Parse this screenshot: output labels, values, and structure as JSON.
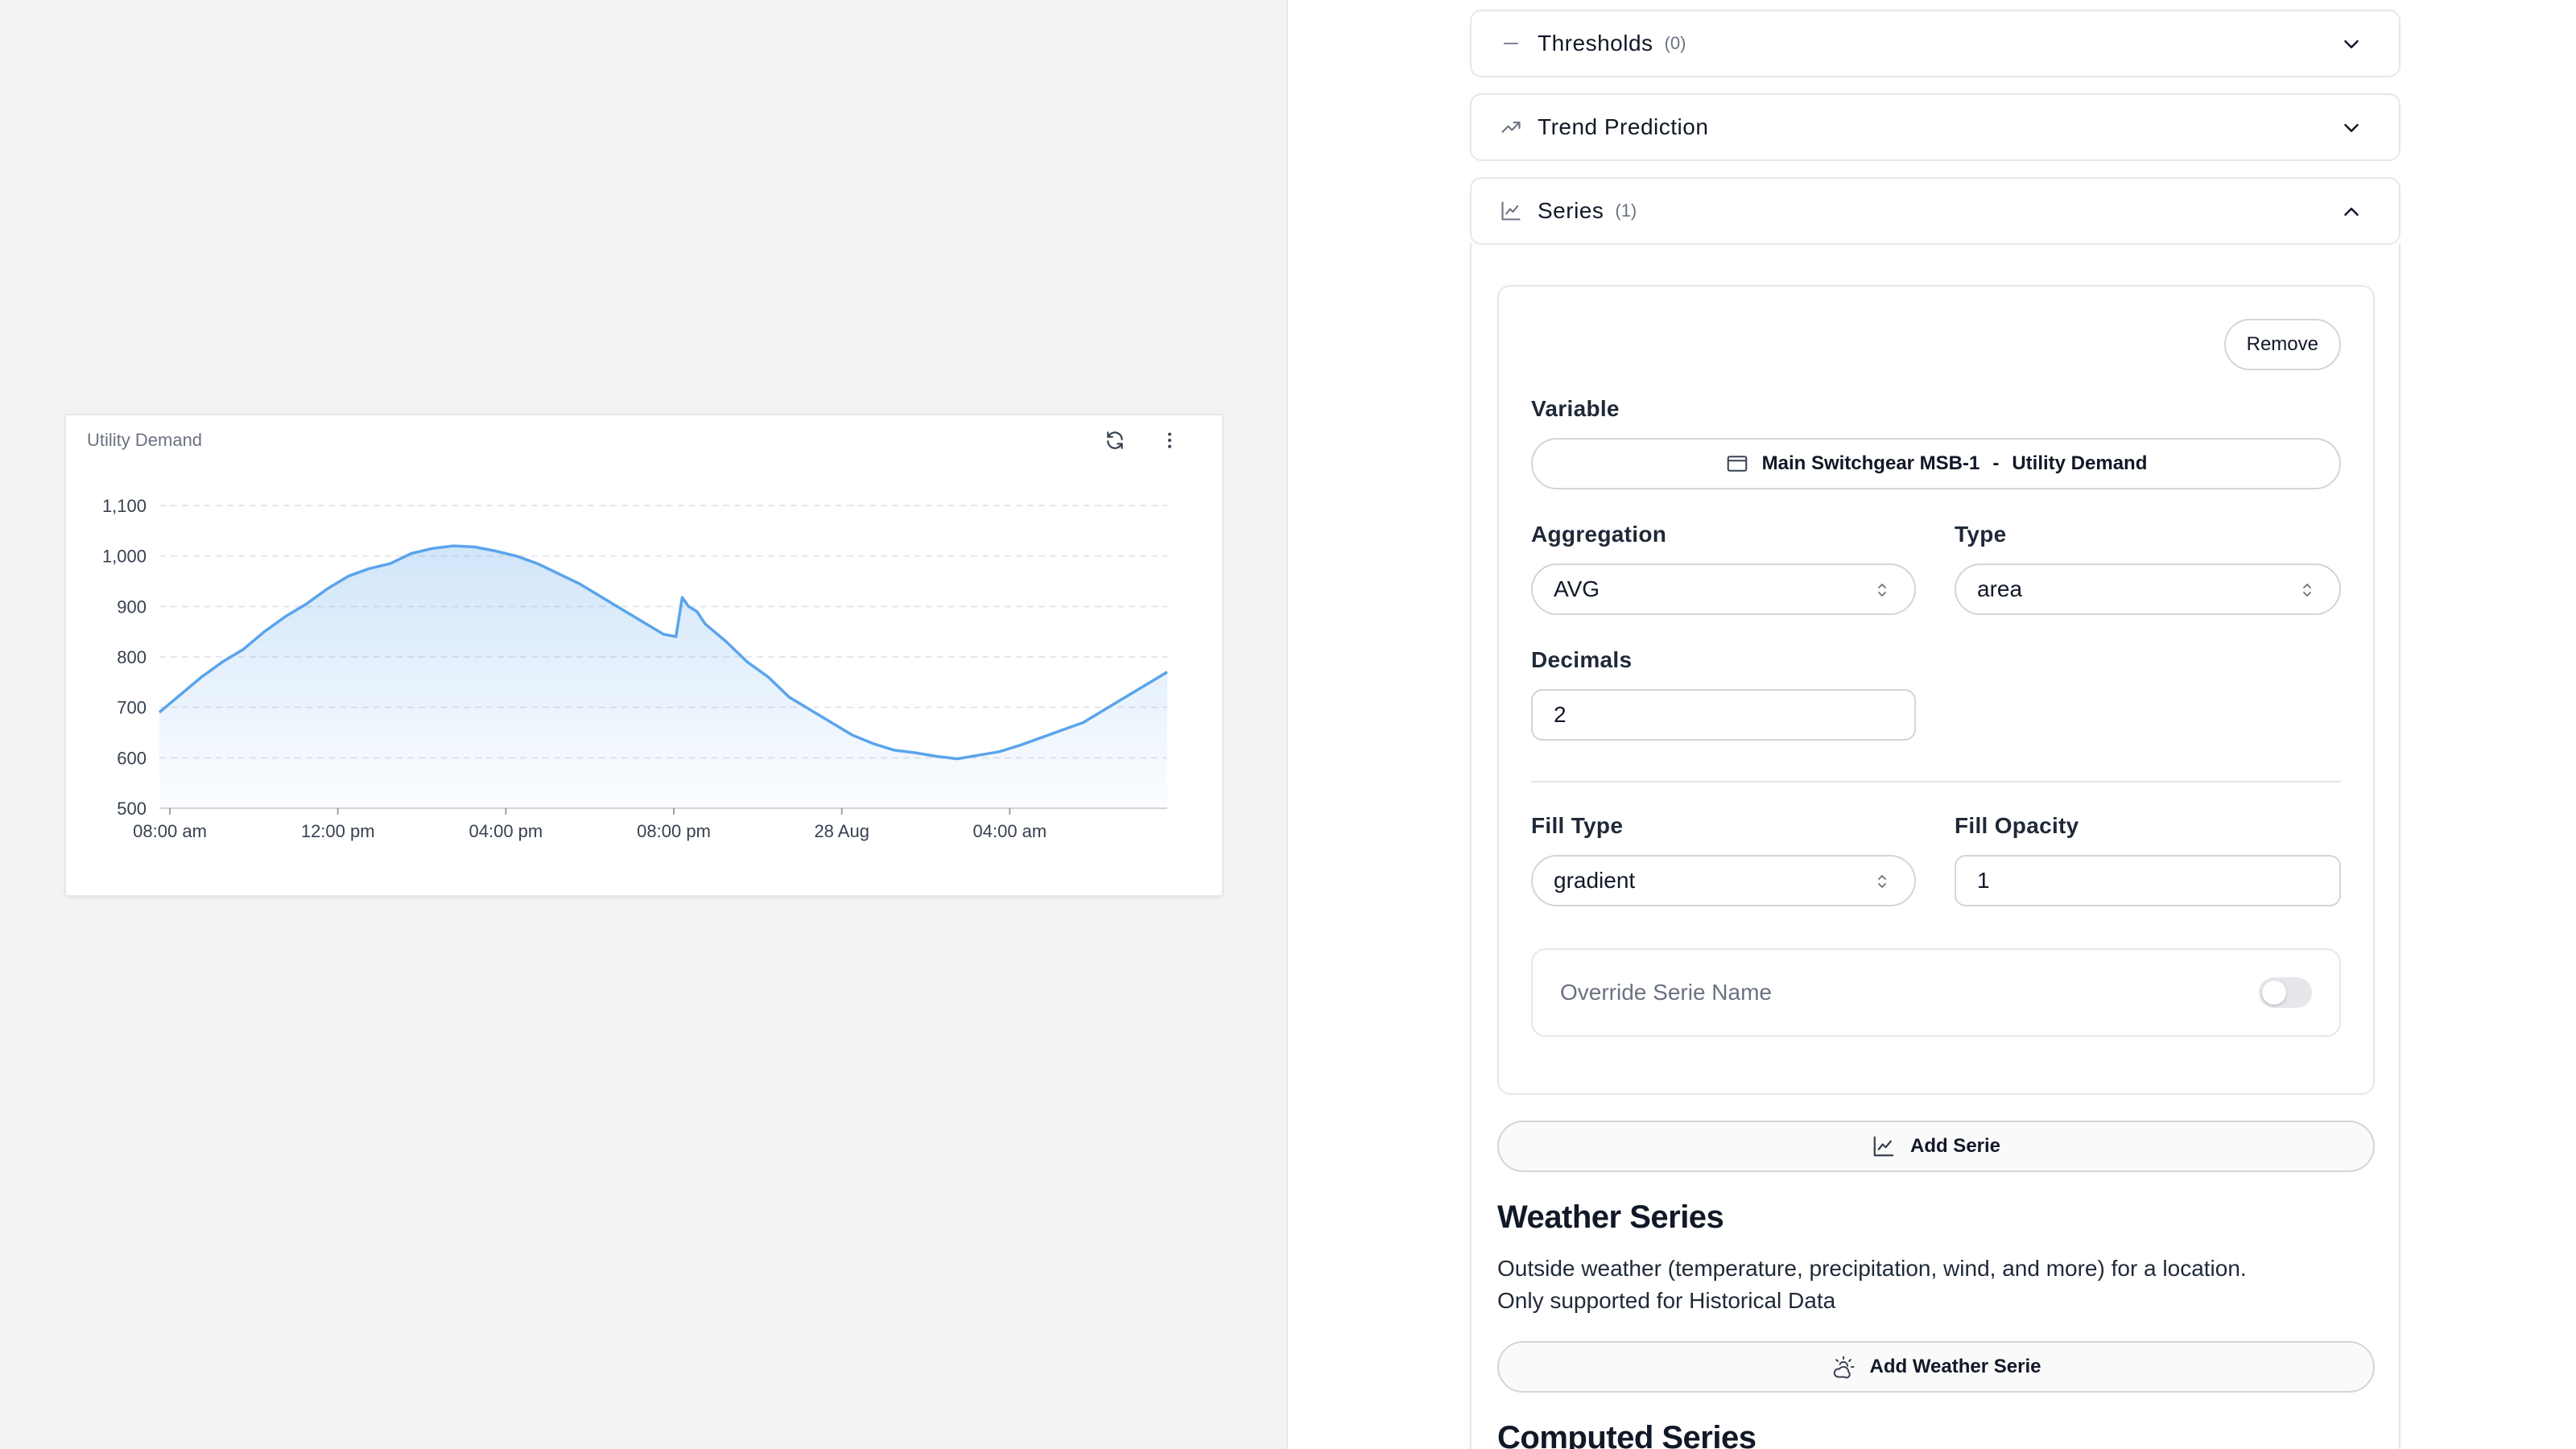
{
  "chart_card": {
    "title": "Utility Demand",
    "refresh_icon": "refresh-icon",
    "menu_icon": "kebab-menu-icon"
  },
  "chart_data": {
    "type": "area",
    "title": "Utility Demand",
    "xlabel": "",
    "ylabel": "",
    "ylim": [
      500,
      1100
    ],
    "yticks": [
      500,
      600,
      700,
      800,
      900,
      1000,
      1100
    ],
    "ytick_labels": [
      "500",
      "600",
      "700",
      "800",
      "900",
      "1,000",
      "1,100"
    ],
    "x_start": "2024-08-27T07:45",
    "x_end": "2024-08-28T07:45",
    "xticks": [
      "08:00 am",
      "12:00 pm",
      "04:00 pm",
      "08:00 pm",
      "28 Aug",
      "04:00 am"
    ],
    "xtick_hours": [
      0.25,
      4.25,
      8.25,
      12.25,
      16.25,
      20.25
    ],
    "grid": true,
    "fill": "gradient",
    "color": "#5aa4ec",
    "series": [
      {
        "hours": [
          0,
          0.5,
          1,
          1.5,
          2,
          2.5,
          3,
          3.5,
          4,
          4.5,
          5,
          5.5,
          6,
          6.5,
          7,
          7.5,
          8,
          8.5,
          9,
          9.5,
          10,
          10.5,
          11,
          11.5,
          12,
          12.3,
          12.45,
          12.6,
          12.8,
          13,
          13.5,
          14,
          14.5,
          15,
          15.5,
          16,
          16.5,
          17,
          17.5,
          18,
          18.5,
          19,
          19.5,
          20,
          20.5,
          21,
          21.5,
          22,
          22.5,
          23,
          23.5,
          24
        ],
        "values": [
          690,
          725,
          760,
          790,
          815,
          850,
          880,
          905,
          935,
          960,
          975,
          985,
          1005,
          1015,
          1020,
          1018,
          1010,
          1000,
          985,
          965,
          945,
          920,
          895,
          870,
          845,
          840,
          918,
          900,
          890,
          865,
          830,
          790,
          760,
          720,
          695,
          670,
          645,
          628,
          615,
          610,
          603,
          598,
          605,
          612,
          625,
          640,
          655,
          670,
          695,
          720,
          745,
          770
        ]
      }
    ]
  },
  "panel": {
    "thresholds": {
      "title": "Thresholds",
      "count": "(0)"
    },
    "trend": {
      "title": "Trend Prediction"
    },
    "series": {
      "title": "Series",
      "count": "(1)",
      "remove_label": "Remove",
      "variable_label": "Variable",
      "variable_device": "Main Switchgear MSB-1",
      "variable_sep": "-",
      "variable_name": "Utility Demand",
      "aggregation_label": "Aggregation",
      "aggregation_value": "AVG",
      "type_label": "Type",
      "type_value": "area",
      "decimals_label": "Decimals",
      "decimals_value": "2",
      "fill_type_label": "Fill Type",
      "fill_type_value": "gradient",
      "fill_opacity_label": "Fill Opacity",
      "fill_opacity_value": "1",
      "override_label": "Override Serie Name",
      "override_enabled": false,
      "add_label": "Add Serie"
    },
    "weather": {
      "title": "Weather Series",
      "desc_line1": "Outside weather (temperature, precipitation, wind, and more) for a location.",
      "desc_line2": "Only supported for Historical Data",
      "add_label": "Add Weather Serie"
    },
    "computed": {
      "title": "Computed Series"
    }
  }
}
